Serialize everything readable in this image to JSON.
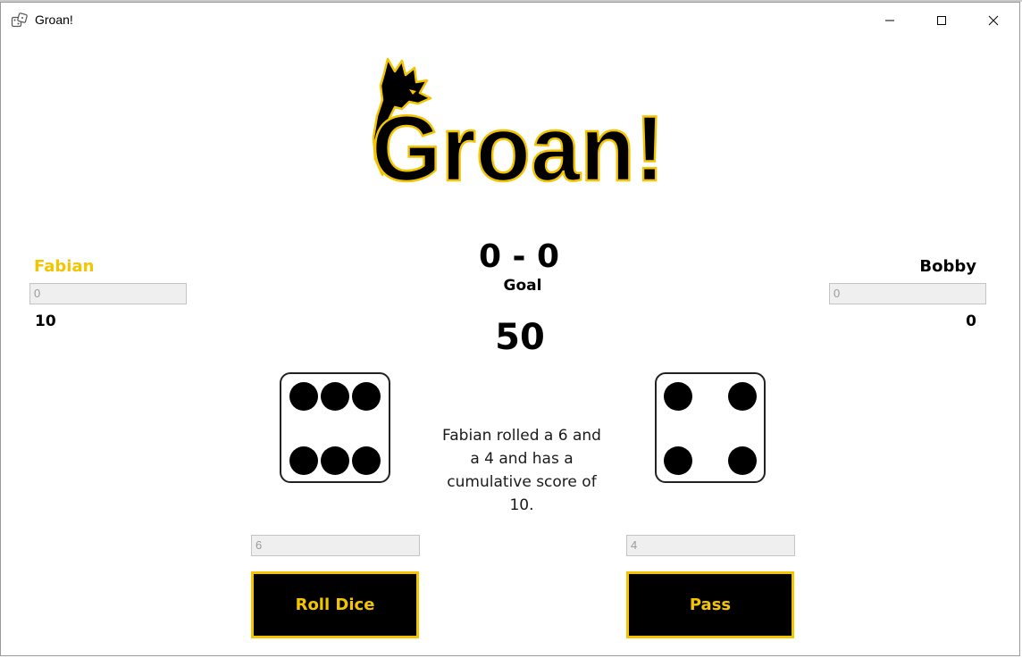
{
  "window": {
    "title": "Groan!",
    "icon": "dice-icon",
    "controls": [
      "minimize-icon",
      "maximize-icon",
      "close-icon"
    ]
  },
  "logo": {
    "text": "Groan!",
    "icon": "dragon-icon",
    "colors": {
      "fill": "#000000",
      "outline": "#f2c500"
    }
  },
  "players": [
    {
      "name": "Fabian",
      "input_value": "0",
      "total": "10",
      "color": "#f2c500"
    },
    {
      "name": "Bobby",
      "input_value": "0",
      "total": "0",
      "color": "#000000"
    }
  ],
  "scoreboard": {
    "score": "0 - 0",
    "goal_label": "Goal",
    "goal_value": "50"
  },
  "dice": [
    {
      "value": 6,
      "input_value": "6"
    },
    {
      "value": 4,
      "input_value": "4"
    }
  ],
  "message": "Fabian rolled a 6 and a 4 and has a cumulative score of 10.",
  "buttons": {
    "roll_label": "Roll Dice",
    "pass_label": "Pass"
  },
  "colors": {
    "accent": "#f2c500",
    "button_bg": "#000000"
  }
}
